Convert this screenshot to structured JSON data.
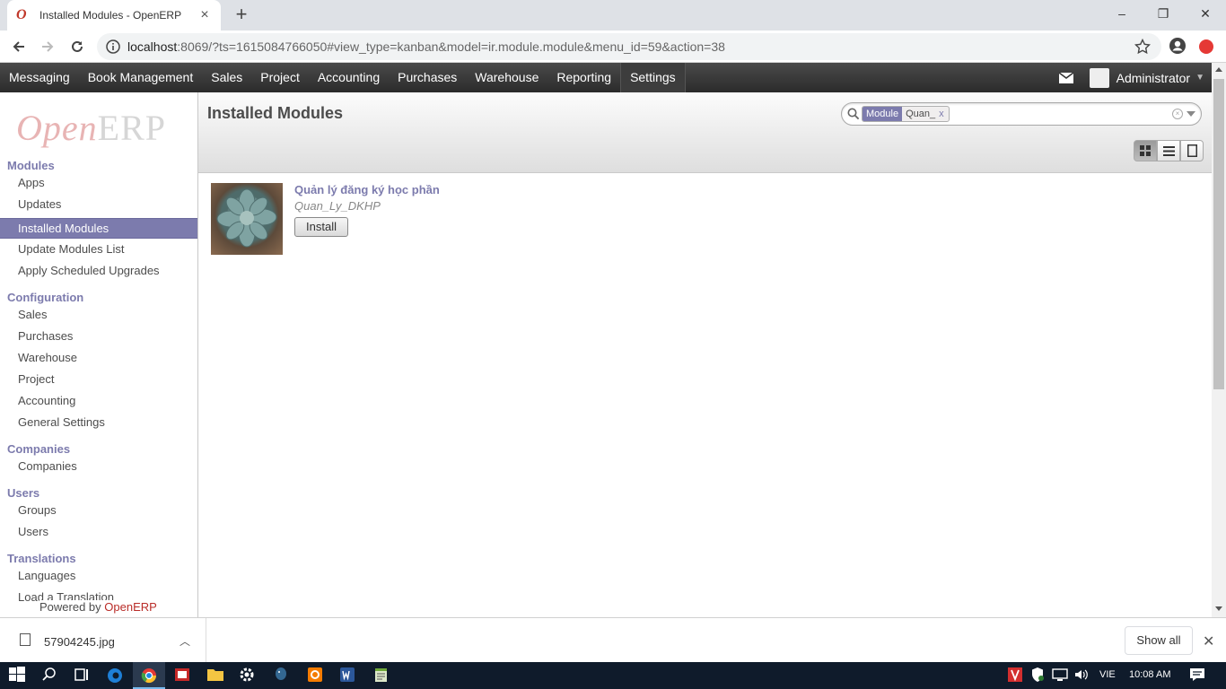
{
  "browser": {
    "tab_title": "Installed Modules - OpenERP",
    "url_host": "localhost",
    "url_rest": ":8069/?ts=1615084766050#view_type=kanban&model=ir.module.module&menu_id=59&action=38"
  },
  "topmenu": {
    "items": [
      "Messaging",
      "Book Management",
      "Sales",
      "Project",
      "Accounting",
      "Purchases",
      "Warehouse",
      "Reporting",
      "Settings"
    ],
    "active": "Settings",
    "user_name": "Administrator"
  },
  "sidebar": {
    "logo_open": "Open",
    "logo_erp": "ERP",
    "sections": [
      {
        "title": "Modules",
        "items": [
          "Apps",
          "Updates",
          "Installed Modules",
          "Update Modules List",
          "Apply Scheduled Upgrades"
        ]
      },
      {
        "title": "Configuration",
        "items": [
          "Sales",
          "Purchases",
          "Warehouse",
          "Project",
          "Accounting",
          "General Settings"
        ]
      },
      {
        "title": "Companies",
        "items": [
          "Companies"
        ]
      },
      {
        "title": "Users",
        "items": [
          "Groups",
          "Users"
        ]
      },
      {
        "title": "Translations",
        "items": [
          "Languages",
          "Load a Translation"
        ]
      }
    ],
    "active_item": "Installed Modules",
    "powered_prefix": "Powered by ",
    "powered_brand": "OpenERP"
  },
  "main": {
    "title": "Installed Modules",
    "search": {
      "facet_category": "Module",
      "facet_value": "Quan_",
      "facet_remove": "x"
    },
    "module": {
      "name": "Quản lý đăng ký học phần",
      "technical_name": "Quan_Ly_DKHP",
      "button": "Install"
    }
  },
  "downloads": {
    "file_name": "57904245.jpg",
    "show_all": "Show all"
  },
  "taskbar": {
    "language": "VIE",
    "time": "10:08 AM"
  },
  "colors": {
    "accent": "#7c7bad",
    "brand_red": "#b92c28",
    "topbar": "#2b2b2b"
  }
}
